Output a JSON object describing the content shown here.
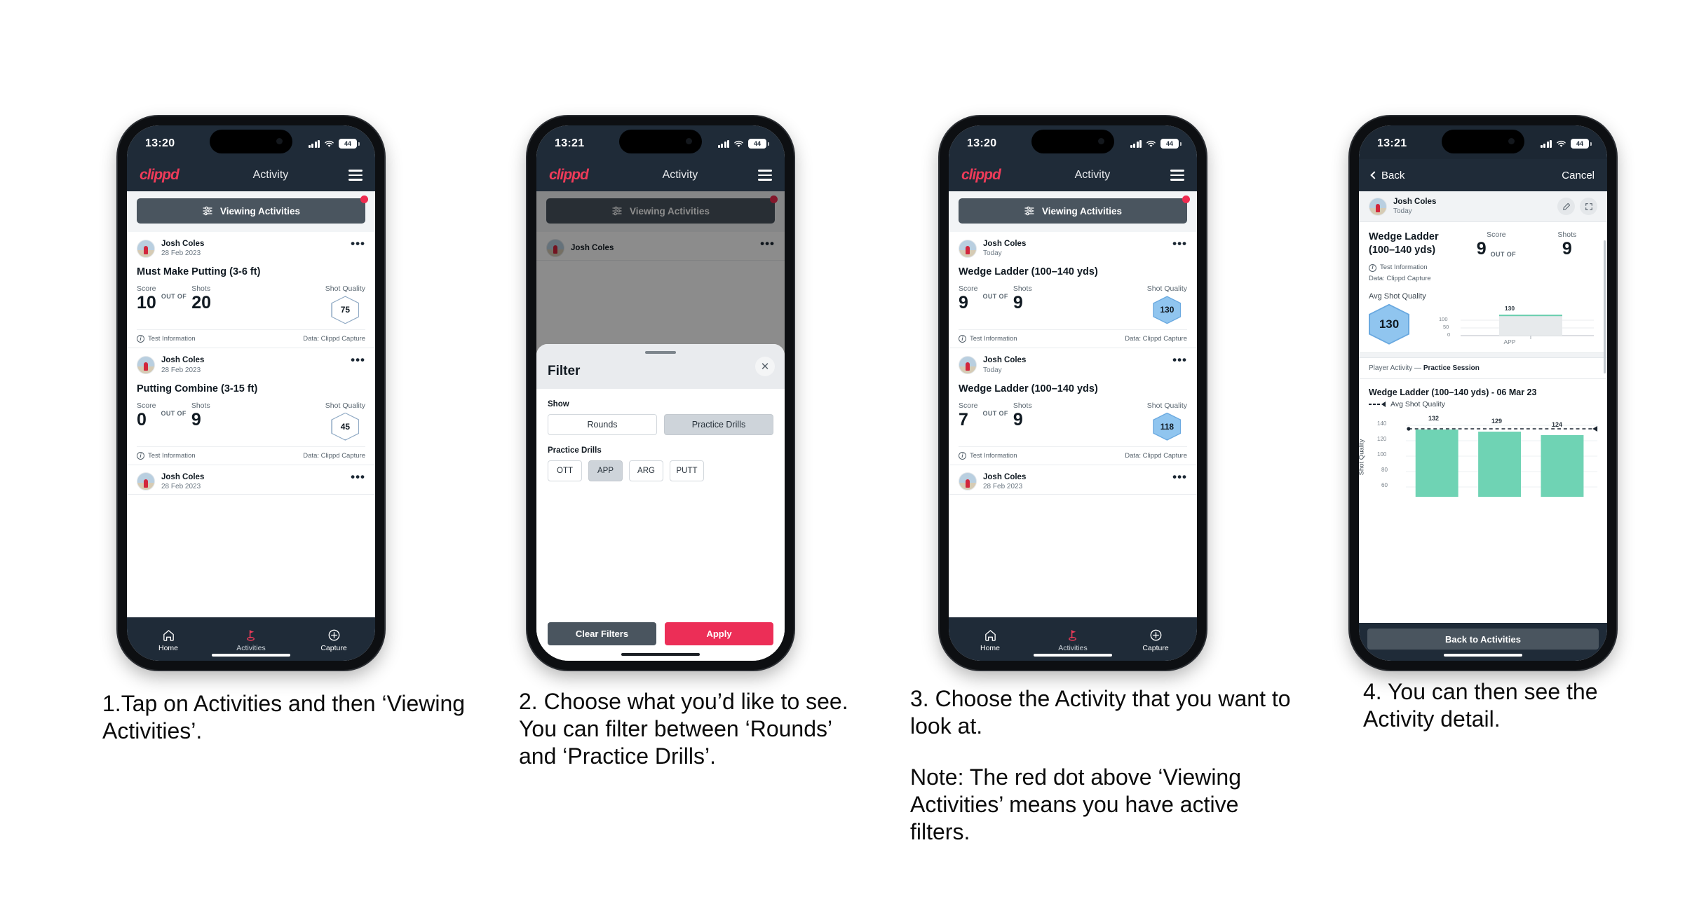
{
  "steps": [
    {
      "caption": [
        "1.Tap on Activities and then ‘Viewing Activities’."
      ],
      "status": {
        "time": "13:20",
        "battery": "44"
      },
      "appbar": {
        "logo": "clippd",
        "title": "Activity",
        "menu_icon": "hamburger-icon"
      },
      "filter_button": {
        "label": "Viewing Activities",
        "icon": "sliders-icon"
      },
      "cards": [
        {
          "user": "Josh Coles",
          "date": "28 Feb 2023",
          "title": "Must Make Putting (3-6 ft)",
          "score_label": "Score",
          "score": "10",
          "outof": "OUT OF",
          "shots_label": "Shots",
          "shots": "20",
          "quality_label": "Shot Quality",
          "quality": "75",
          "quality_style": "outline",
          "foot_left": "Test Information",
          "foot_right": "Data: Clippd Capture"
        },
        {
          "user": "Josh Coles",
          "date": "28 Feb 2023",
          "title": "Putting Combine (3-15 ft)",
          "score_label": "Score",
          "score": "0",
          "outof": "OUT OF",
          "shots_label": "Shots",
          "shots": "9",
          "quality_label": "Shot Quality",
          "quality": "45",
          "quality_style": "outline",
          "foot_left": "Test Information",
          "foot_right": "Data: Clippd Capture"
        },
        {
          "user": "Josh Coles",
          "date": "28 Feb 2023"
        }
      ],
      "tabs": [
        {
          "label": "Home",
          "icon": "home-icon"
        },
        {
          "label": "Activities",
          "icon": "golf-flag-icon"
        },
        {
          "label": "Capture",
          "icon": "plus-circle-icon"
        }
      ]
    },
    {
      "caption": [
        "2. Choose what you’d like to see. You can filter between ‘Rounds’ and ‘Practice Drills’."
      ],
      "status": {
        "time": "13:21",
        "battery": "44"
      },
      "appbar": {
        "logo": "clippd",
        "title": "Activity",
        "menu_icon": "hamburger-icon"
      },
      "filter_button": {
        "label": "Viewing Activities",
        "icon": "sliders-icon"
      },
      "behind_card": {
        "user": "Josh Coles"
      },
      "sheet": {
        "title": "Filter",
        "close_icon": "close-icon",
        "show_label": "Show",
        "show_options": [
          {
            "label": "Rounds",
            "selected": false
          },
          {
            "label": "Practice Drills",
            "selected": true
          }
        ],
        "drills_label": "Practice Drills",
        "drill_options": [
          {
            "label": "OTT",
            "selected": false
          },
          {
            "label": "APP",
            "selected": true
          },
          {
            "label": "ARG",
            "selected": false
          },
          {
            "label": "PUTT",
            "selected": false
          }
        ],
        "clear_label": "Clear Filters",
        "apply_label": "Apply"
      }
    },
    {
      "caption": [
        "3. Choose the Activity that you want to look at.",
        "Note: The red dot above ‘Viewing Activities’ means you have active filters."
      ],
      "status": {
        "time": "13:20",
        "battery": "44"
      },
      "appbar": {
        "logo": "clippd",
        "title": "Activity",
        "menu_icon": "hamburger-icon"
      },
      "filter_button": {
        "label": "Viewing Activities",
        "icon": "sliders-icon"
      },
      "cards": [
        {
          "user": "Josh Coles",
          "date": "Today",
          "title": "Wedge Ladder (100–140 yds)",
          "score_label": "Score",
          "score": "9",
          "outof": "OUT OF",
          "shots_label": "Shots",
          "shots": "9",
          "quality_label": "Shot Quality",
          "quality": "130",
          "quality_style": "filled",
          "foot_left": "Test Information",
          "foot_right": "Data: Clippd Capture"
        },
        {
          "user": "Josh Coles",
          "date": "Today",
          "title": "Wedge Ladder (100–140 yds)",
          "score_label": "Score",
          "score": "7",
          "outof": "OUT OF",
          "shots_label": "Shots",
          "shots": "9",
          "quality_label": "Shot Quality",
          "quality": "118",
          "quality_style": "filled",
          "foot_left": "Test Information",
          "foot_right": "Data: Clippd Capture"
        },
        {
          "user": "Josh Coles",
          "date": "28 Feb 2023"
        }
      ],
      "tabs": [
        {
          "label": "Home",
          "icon": "home-icon"
        },
        {
          "label": "Activities",
          "icon": "golf-flag-icon"
        },
        {
          "label": "Capture",
          "icon": "plus-circle-icon"
        }
      ]
    },
    {
      "caption": [
        "4. You can then see the Activity detail."
      ],
      "status": {
        "time": "13:21",
        "battery": "44"
      },
      "navbar": {
        "back": "Back",
        "cancel": "Cancel",
        "back_icon": "chevron-left-icon"
      },
      "detail": {
        "user": "Josh Coles",
        "date": "Today",
        "edit_icon": "pencil-icon",
        "expand_icon": "expand-icon",
        "title": "Wedge Ladder (100–140 yds)",
        "score_label": "Score",
        "score": "9",
        "outof": "OUT OF",
        "shots_label": "Shots",
        "shots": "9",
        "info_line": "Test Information",
        "data_line": "Data: Clippd Capture",
        "avg_label": "Avg Shot Quality",
        "avg_value": "130",
        "breadcrumb_prefix": "Player Activity — ",
        "breadcrumb_bold": "Practice Session",
        "chart_title": "Wedge Ladder (100–140 yds) - 06 Mar 23",
        "legend_label": "Avg Shot Quality",
        "back_button": "Back to Activities"
      }
    }
  ],
  "chart_data": [
    {
      "type": "bar",
      "name": "avg-shot-quality-mini",
      "categories": [
        "APP"
      ],
      "values": [
        130
      ],
      "labels": [
        "130"
      ],
      "title": "",
      "ylabel": "",
      "yticks": [
        0,
        50,
        100
      ],
      "ylim": [
        0,
        140
      ],
      "bar_color": "#e7eaec",
      "cap_color": "#6ecfb0",
      "grid": true,
      "legend": "none"
    },
    {
      "type": "bar",
      "name": "shot-quality-by-shot",
      "title": "Wedge Ladder (100–140 yds) - 06 Mar 23",
      "categories": [
        "1",
        "2",
        "3"
      ],
      "values": [
        132,
        129,
        124
      ],
      "labels": [
        "132",
        "129",
        "124"
      ],
      "ylabel": "Shot Quality",
      "yticks": [
        60,
        80,
        100,
        120,
        140
      ],
      "ylim": [
        50,
        145
      ],
      "bar_color": "#6fd3b4",
      "avg_line": 131,
      "avg_line_label": "Avg Shot Quality",
      "grid": true,
      "legend": "top-left"
    }
  ],
  "colors": {
    "brand_pink": "#ee3b59",
    "apply_pink": "#ec2e57",
    "dark_navy": "#1f2b38",
    "slate": "#4a555f",
    "hex_blue": "#90c5ef",
    "bar_green": "#6fd3b4",
    "red_dot": "#ee2a4f"
  }
}
